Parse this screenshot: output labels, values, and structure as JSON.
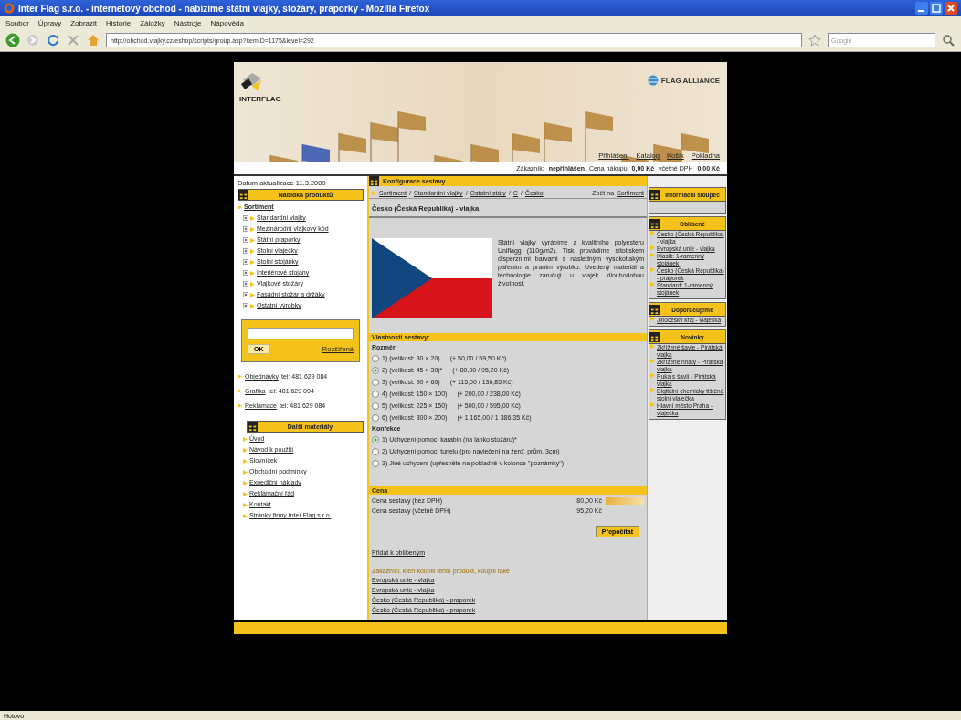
{
  "window": {
    "title": "Inter Flag s.r.o. - internetový obchod - nabízíme státní vlajky, stožáry, praporky - Mozilla Firefox"
  },
  "menu": [
    "Soubor",
    "Úpravy",
    "Zobrazit",
    "Historie",
    "Záložky",
    "Nástroje",
    "Nápověda"
  ],
  "address_bar": {
    "value": "http://obchod.vlajky.cz/eshop/scripts/group.asp?itemID=1175&level=292"
  },
  "search": {
    "placeholder": "Google"
  },
  "header": {
    "logo": "INTERFLAG",
    "partner_logo": "FLAG ALLIANCE",
    "nav": [
      "Přihlášení",
      "Katalog",
      "Košík",
      "Pokladna"
    ],
    "customer_label": "Zákazník:",
    "customer_value": "nepřihlášen",
    "cart_label": "Cena nákupu",
    "cart_value": "0,00 Kč",
    "vat_label": "včetně DPH",
    "vat_value": "0,00 Kč"
  },
  "left": {
    "date": "Datum aktualizace 11.3.2009",
    "products_title": "Nabídka produktů",
    "root": "Sortiment",
    "categories": [
      "Standardní vlajky",
      "Mezinárodní vlajkový kód",
      "Státní praporky",
      "Stolní vlaječky",
      "Stolní stojánky",
      "Interiérové stojany",
      "Vlajkové stožáry",
      "Fasádní stožár a držáky",
      "Ostatní výrobky"
    ],
    "search_button": "OK",
    "advanced_link": "Rozšířená",
    "contacts": [
      {
        "link": "Objednávky",
        "text": "tel: 481 629 084"
      },
      {
        "link": "Grafika",
        "text": "tel: 481 629 094"
      },
      {
        "link": "Reklamace",
        "text": "tel: 481 629 084"
      }
    ],
    "more_title": "Další materiály",
    "more": [
      "Úvod",
      "Návod k použití",
      "Slovníček",
      "Obchodní podmínky",
      "Expediční náklady",
      "Reklamační řád",
      "Kontakt",
      "Stránky firmy Inter Flag s.r.o."
    ]
  },
  "center": {
    "title": "Konfigurace sestavy",
    "breadcrumb": [
      {
        "label": "Sortiment",
        "separator": "/"
      },
      {
        "label": "Standardní vlajky",
        "separator": "/"
      },
      {
        "label": "Ostatní státy",
        "separator": "/"
      },
      {
        "label": "C",
        "separator": "/"
      },
      {
        "label": "Česko"
      }
    ],
    "back_label": "Zpět na",
    "back_link": "Sortiment",
    "product_title": "Česko (Česká Republika) - vlajka",
    "description": "Státní vlajky vyrábíme z kvalitního polyesteru Uniflagg (110g/m2). Tisk provádíme sítotiskem disperzními barvami s následným vysokotlakým pařením a praním výrobku. Uvedený materiál a technologie zaručují u vlajek dlouhodobou životnost.",
    "properties_title": "Vlastnosti sestavy:",
    "groups": [
      {
        "title": "Rozměr",
        "options": [
          {
            "label": "1) (velikost: 30 × 20)",
            "price": "(+ 50,00 / 59,50 Kč)",
            "selected": false
          },
          {
            "label": "2) (velikost: 45 × 30)*",
            "price": "(+ 80,00 / 95,20 Kč)",
            "selected": true
          },
          {
            "label": "3) (velikost: 90 × 60)",
            "price": "(+ 115,00 / 136,85 Kč)",
            "selected": false
          },
          {
            "label": "4) (velikost: 150 × 100)",
            "price": "(+ 200,00 / 238,00 Kč)",
            "selected": false
          },
          {
            "label": "5) (velikost: 225 × 150)",
            "price": "(+ 500,00 / 595,00 Kč)",
            "selected": false
          },
          {
            "label": "6) (velikost: 300 × 200)",
            "price": "(+ 1 165,00 / 1 386,35 Kč)",
            "selected": false
          }
        ]
      },
      {
        "title": "Konfekce",
        "options": [
          {
            "label": "1) Uchycení pomocí karabin (na lanko stožáru)*",
            "selected": true
          },
          {
            "label": "2) Uchycení pomocí tunelu (pro navlečení na žerď, prům. 3cm)",
            "selected": false
          },
          {
            "label": "3) Jiné uchycení (upřesněte na pokladně v kolonce \"poznámky\")",
            "selected": false
          }
        ]
      }
    ],
    "price_title": "Cena",
    "prices": [
      {
        "label": "Cena sestavy (bez DPH)",
        "value": "80,00 Kč"
      },
      {
        "label": "Cena sestavy (včetně DPH)",
        "value": "95,20 Kč"
      }
    ],
    "recalc_button": "Přepočítat",
    "favorite_link": "Přidat k oblíbeným",
    "related_title": "Zákazníci, kteří koupili tento produkt, koupili také",
    "related": [
      "Evropská unie - vlajka",
      "Evropská unie - vlajka",
      "Česko (Česká Republika) - praporek",
      "Česko (Česká Republika) - praporek"
    ]
  },
  "right": [
    {
      "title": "Informační sloupec"
    },
    {
      "title": "Oblíbené",
      "items": [
        "Česko (Česká Republika) - vlajka",
        "Evropská unie - vlajka",
        "Klasik: 1-ramenný stojánek",
        "Česko (Česká Republika) - praporek",
        "Standard: 1-ramenný stojánek"
      ]
    },
    {
      "title": "Doporučujeme",
      "items": [
        "Jihočeský kraj - vlaječka"
      ]
    },
    {
      "title": "Novinky",
      "items": [
        "Zkřížené šavle - Pirátská vlajka",
        "Zkřížené hnáty - Pirátská vlajka",
        "Ruka s šavlí - Pirátská vlajka",
        "Digitální chemicky tištěná stolní vlaječka",
        "Hlavní město Praha - vlaječka"
      ]
    }
  ],
  "status_bar": "Hotovo"
}
